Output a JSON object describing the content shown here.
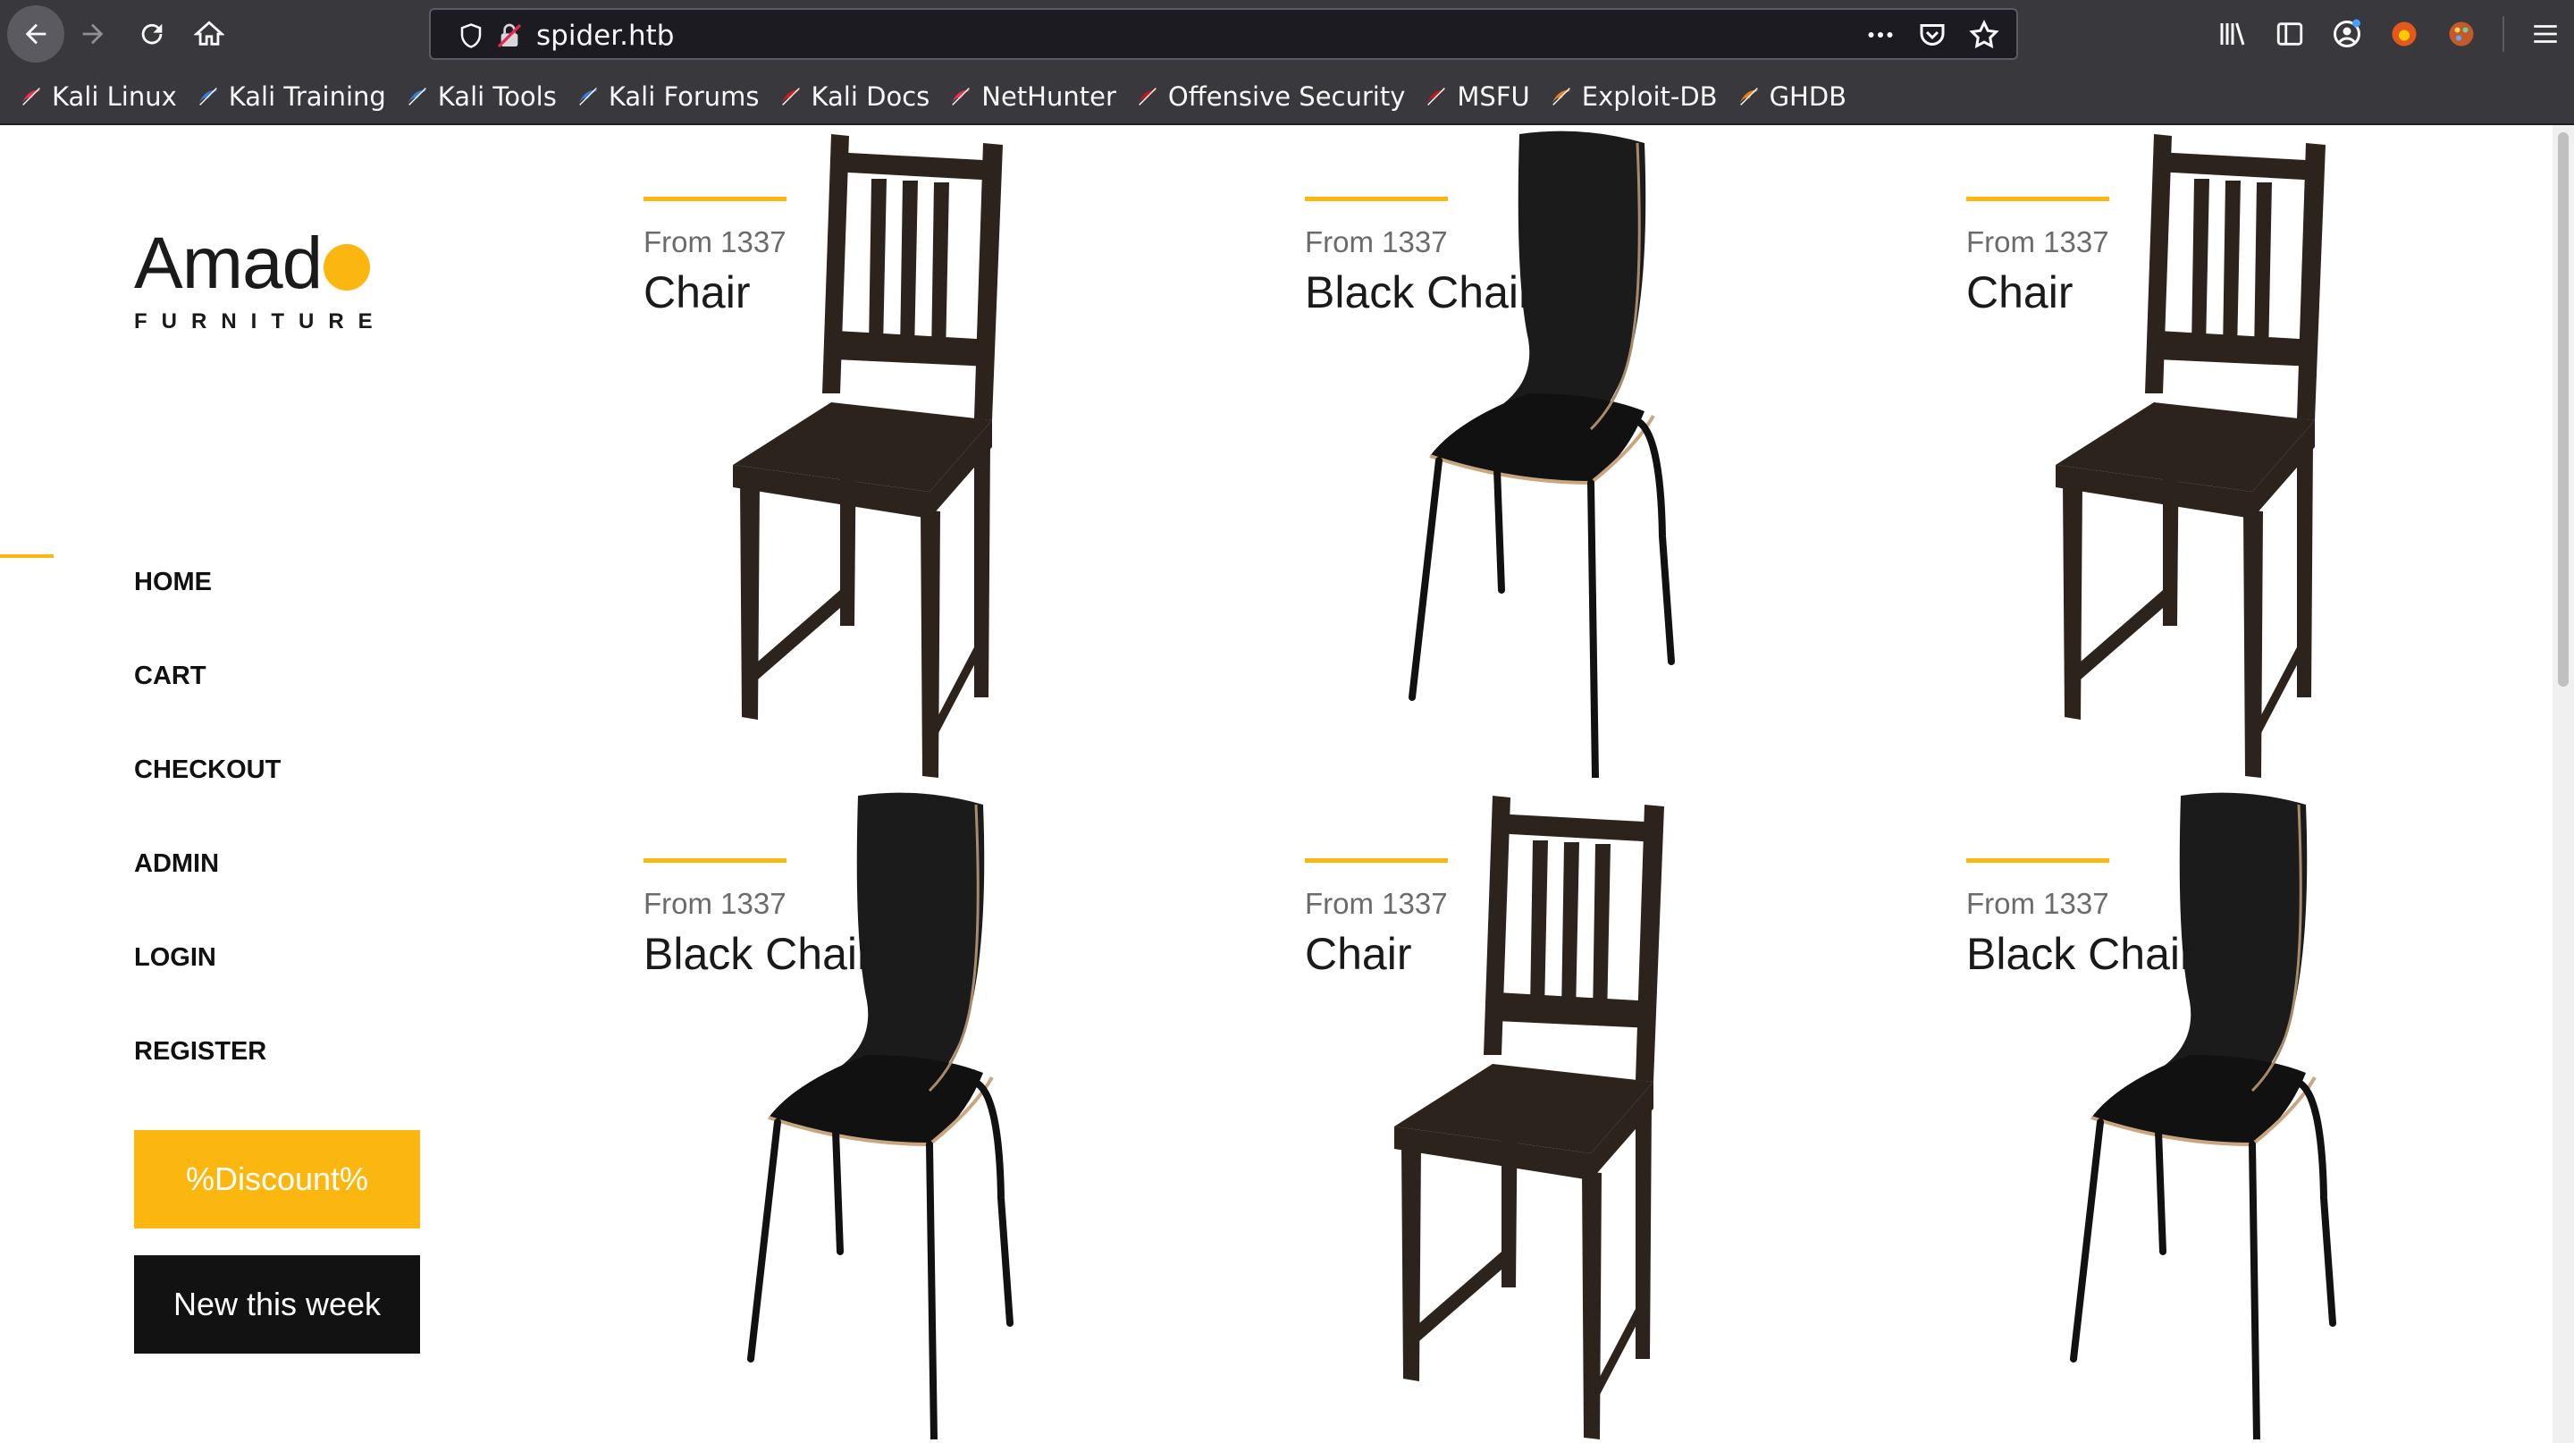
{
  "browser": {
    "url": "spider.htb",
    "bookmarks": [
      {
        "label": "Kali Linux",
        "icon": "kali-icon"
      },
      {
        "label": "Kali Training",
        "icon": "kali-training-icon"
      },
      {
        "label": "Kali Tools",
        "icon": "kali-tools-icon"
      },
      {
        "label": "Kali Forums",
        "icon": "kali-forums-icon"
      },
      {
        "label": "Kali Docs",
        "icon": "kali-docs-icon"
      },
      {
        "label": "NetHunter",
        "icon": "nethunter-icon"
      },
      {
        "label": "Offensive Security",
        "icon": "offsec-icon"
      },
      {
        "label": "MSFU",
        "icon": "msfu-icon"
      },
      {
        "label": "Exploit-DB",
        "icon": "exploitdb-icon"
      },
      {
        "label": "GHDB",
        "icon": "ghdb-icon"
      }
    ]
  },
  "site": {
    "logo": {
      "word": "Amad",
      "sub": "FURNITURE"
    },
    "menu": [
      "HOME",
      "CART",
      "CHECKOUT",
      "ADMIN",
      "LOGIN",
      "REGISTER"
    ],
    "buttons": {
      "discount": "%Discount%",
      "new": "New this week"
    },
    "accent": "#fbb710",
    "products": [
      {
        "price": "From 1337",
        "name": "Chair",
        "type": "wood"
      },
      {
        "price": "From 1337",
        "name": "Black Chair",
        "type": "black"
      },
      {
        "price": "From 1337",
        "name": "Chair",
        "type": "wood"
      },
      {
        "price": "From 1337",
        "name": "Black Chair",
        "type": "black"
      },
      {
        "price": "From 1337",
        "name": "Chair",
        "type": "wood"
      },
      {
        "price": "From 1337",
        "name": "Black Chair",
        "type": "black"
      }
    ]
  }
}
